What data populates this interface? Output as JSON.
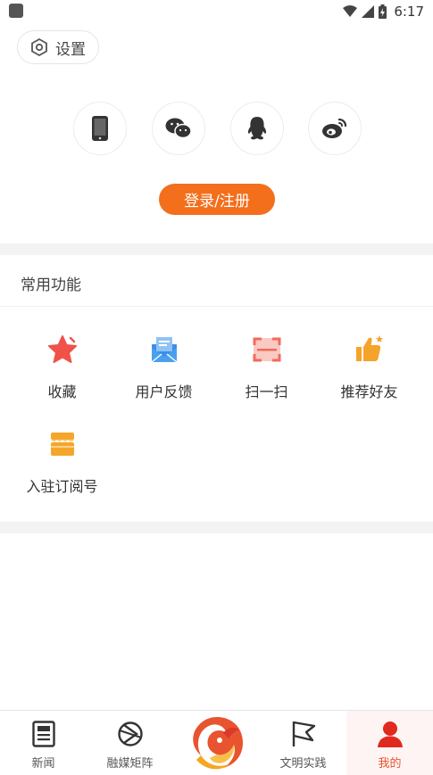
{
  "status_bar": {
    "time": "6:17"
  },
  "settings": {
    "label": "设置"
  },
  "login": {
    "methods": [
      {
        "icon": "phone-icon"
      },
      {
        "icon": "wechat-icon"
      },
      {
        "icon": "qq-icon"
      },
      {
        "icon": "weibo-icon"
      }
    ],
    "button_label": "登录/注册"
  },
  "common_functions": {
    "title": "常用功能",
    "items": [
      {
        "label": "收藏",
        "icon": "star-icon"
      },
      {
        "label": "用户反馈",
        "icon": "mail-icon"
      },
      {
        "label": "扫一扫",
        "icon": "scan-icon"
      },
      {
        "label": "推荐好友",
        "icon": "thumbs-up-icon"
      },
      {
        "label": "入驻订阅号",
        "icon": "store-icon"
      }
    ]
  },
  "bottom_nav": {
    "items": [
      {
        "label": "新闻",
        "icon": "news-icon"
      },
      {
        "label": "融媒矩阵",
        "icon": "media-matrix-icon"
      },
      {
        "label": "",
        "icon": "app-logo-icon"
      },
      {
        "label": "文明实践",
        "icon": "flag-icon"
      },
      {
        "label": "我的",
        "icon": "person-icon",
        "active": true
      }
    ]
  },
  "colors": {
    "accent": "#f36f1c",
    "active_nav": "#e8542f",
    "star": "#f0524a",
    "mail": "#3b8fe6",
    "scan": "#f36a5d",
    "thumb": "#f5a32a",
    "store": "#f5a62a"
  }
}
